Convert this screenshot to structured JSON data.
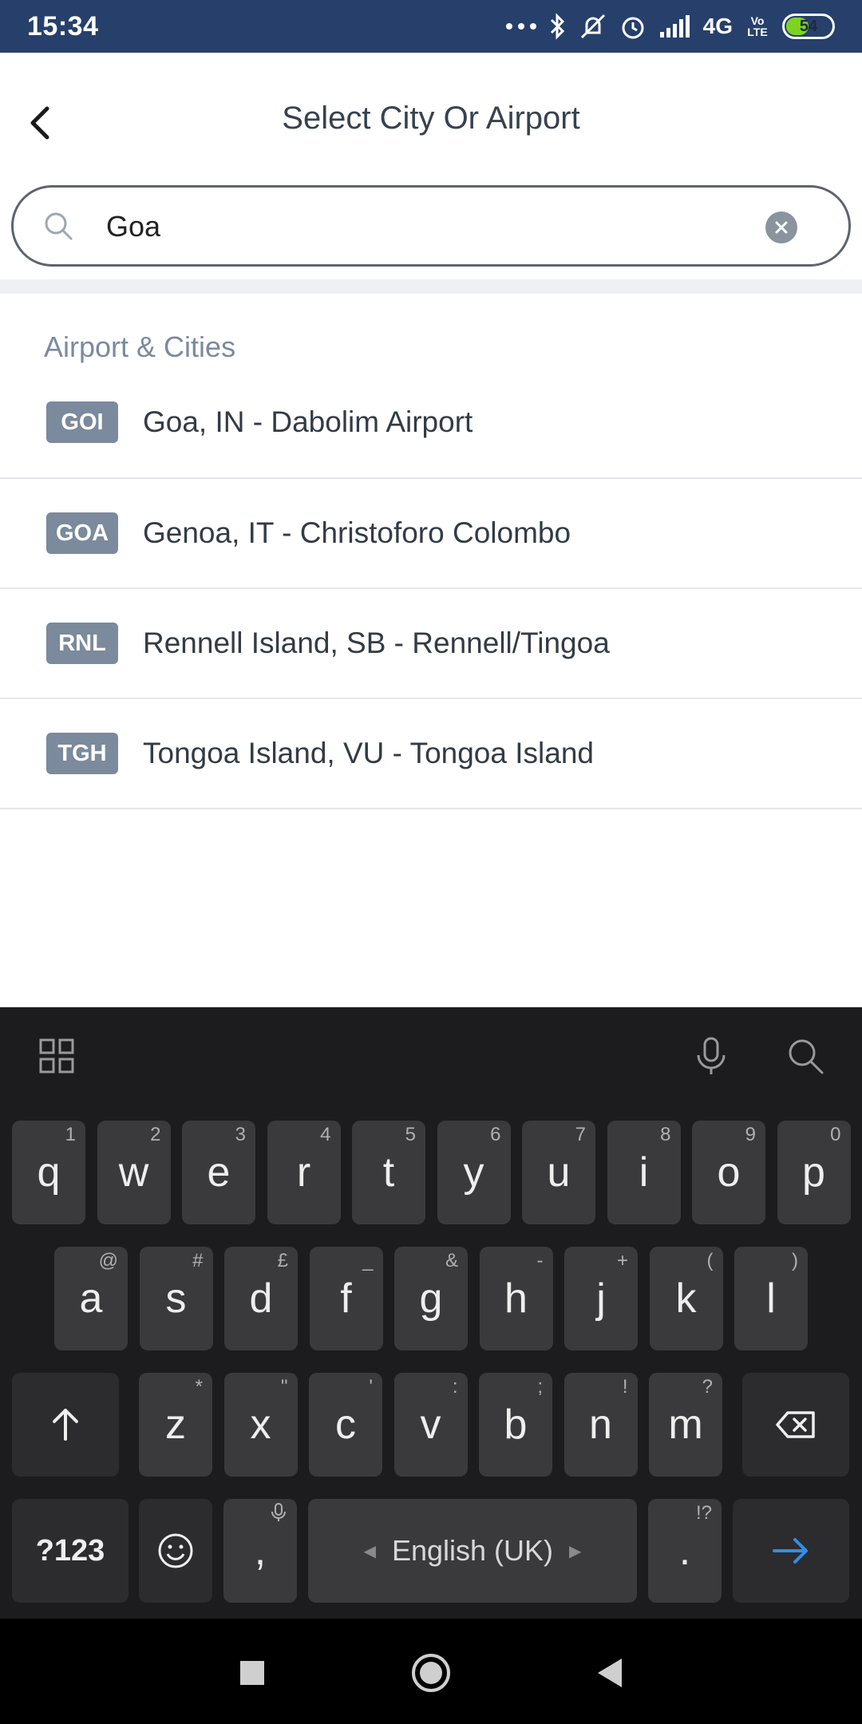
{
  "status_bar": {
    "time": "15:34",
    "network": "4G",
    "volte": "Vo LTE",
    "battery": "54",
    "battery_level": 0.54
  },
  "header": {
    "title": "Select City Or Airport"
  },
  "search": {
    "value": "Goa",
    "placeholder": ""
  },
  "section": {
    "title": "Airport & Cities"
  },
  "results": [
    {
      "code": "GOI",
      "label": "Goa, IN - Dabolim Airport"
    },
    {
      "code": "GOA",
      "label": "Genoa, IT - Christoforo Colombo"
    },
    {
      "code": "RNL",
      "label": "Rennell Island, SB - Rennell/Tingoa"
    },
    {
      "code": "TGH",
      "label": "Tongoa Island, VU - Tongoa Island"
    }
  ],
  "keyboard": {
    "row1": [
      {
        "k": "q",
        "h": "1"
      },
      {
        "k": "w",
        "h": "2"
      },
      {
        "k": "e",
        "h": "3"
      },
      {
        "k": "r",
        "h": "4"
      },
      {
        "k": "t",
        "h": "5"
      },
      {
        "k": "y",
        "h": "6"
      },
      {
        "k": "u",
        "h": "7"
      },
      {
        "k": "i",
        "h": "8"
      },
      {
        "k": "o",
        "h": "9"
      },
      {
        "k": "p",
        "h": "0"
      }
    ],
    "row2": [
      {
        "k": "a",
        "h": "@"
      },
      {
        "k": "s",
        "h": "#"
      },
      {
        "k": "d",
        "h": "£"
      },
      {
        "k": "f",
        "h": "_"
      },
      {
        "k": "g",
        "h": "&"
      },
      {
        "k": "h",
        "h": "-"
      },
      {
        "k": "j",
        "h": "+"
      },
      {
        "k": "k",
        "h": "("
      },
      {
        "k": "l",
        "h": ")"
      }
    ],
    "row3": [
      {
        "k": "z",
        "h": "*"
      },
      {
        "k": "x",
        "h": "\""
      },
      {
        "k": "c",
        "h": "'"
      },
      {
        "k": "v",
        "h": ":"
      },
      {
        "k": "b",
        "h": ";"
      },
      {
        "k": "n",
        "h": "!"
      },
      {
        "k": "m",
        "h": "?"
      }
    ],
    "symbols_label": "?123",
    "comma": ",",
    "period": ".",
    "period_hint": "!?",
    "space_label": "English (UK)",
    "accent_color": "#2f8fe8"
  }
}
